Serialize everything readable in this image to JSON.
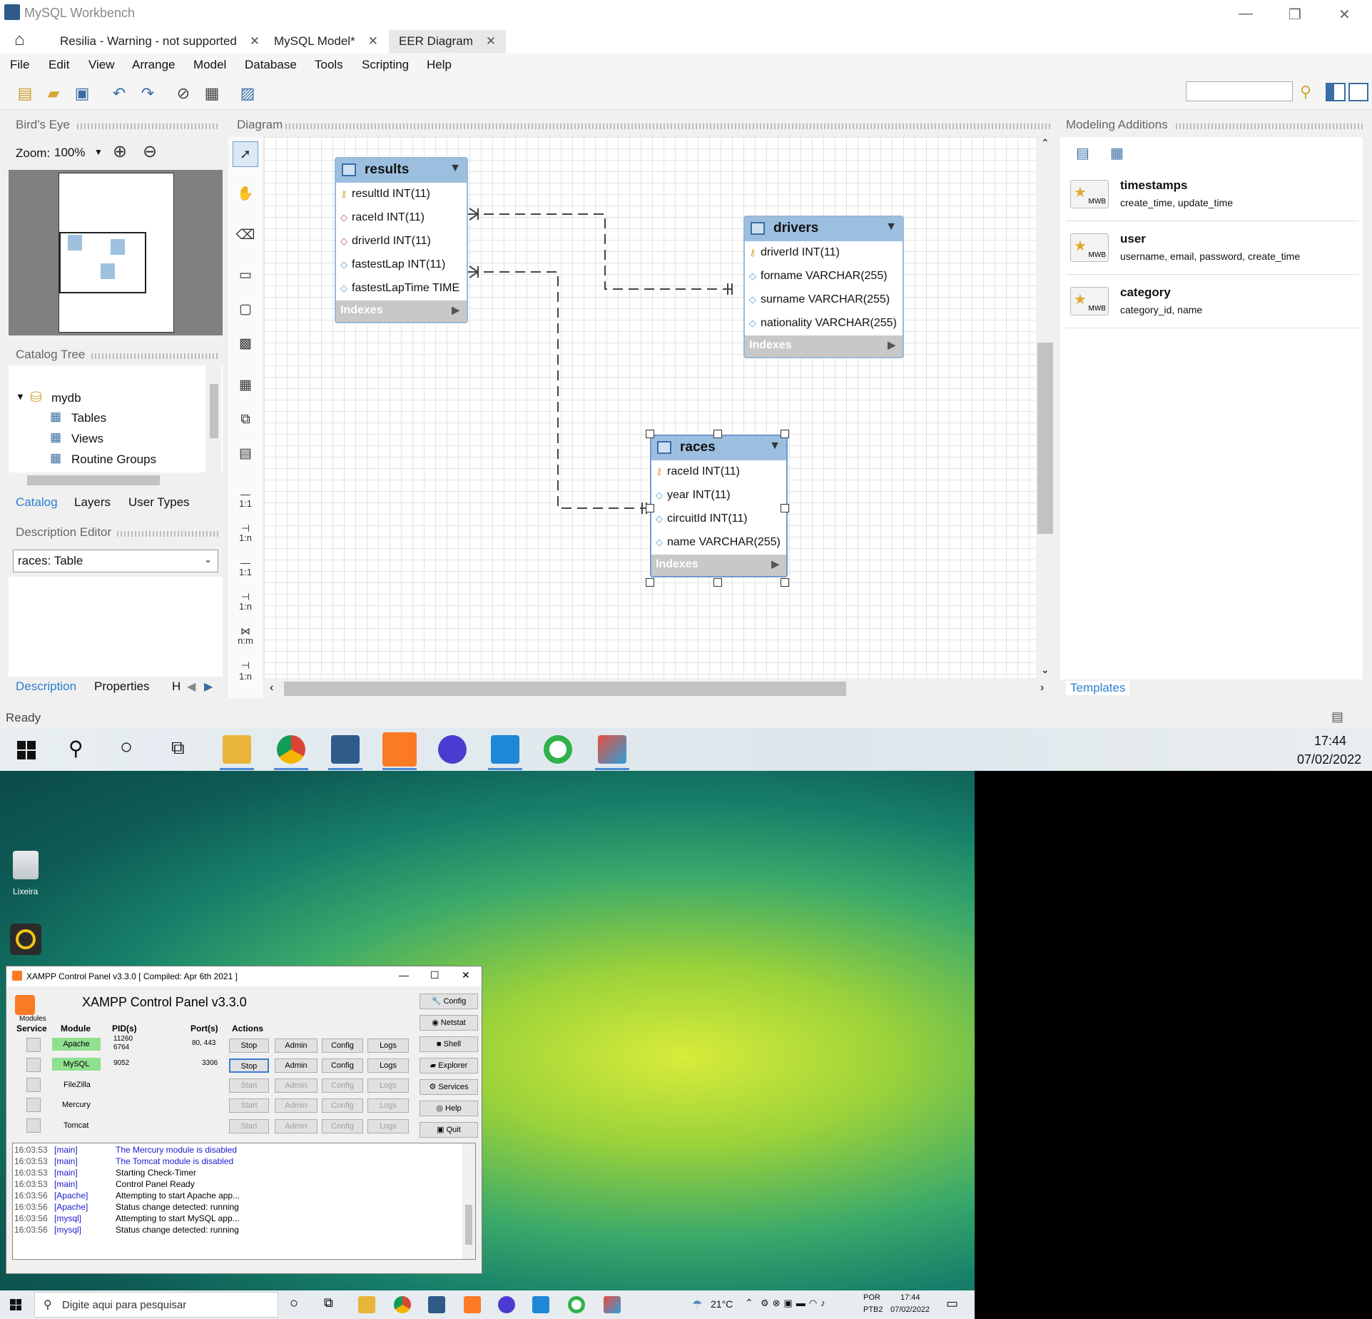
{
  "workbench": {
    "title": "MySQL Workbench",
    "tabs": [
      {
        "label": "Resilia - Warning - not supported"
      },
      {
        "label": "MySQL Model*"
      },
      {
        "label": "EER Diagram"
      }
    ],
    "menu": [
      "File",
      "Edit",
      "View",
      "Arrange",
      "Model",
      "Database",
      "Tools",
      "Scripting",
      "Help"
    ],
    "panels": {
      "birds_eye": "Bird's Eye",
      "zoom_label": "Zoom:",
      "zoom_value": "100%",
      "catalog_tree": "Catalog Tree",
      "diagram": "Diagram",
      "modeling_additions": "Modeling Additions",
      "description_editor": "Description Editor"
    },
    "catalog": {
      "root": "mydb",
      "items": [
        "Tables",
        "Views",
        "Routine Groups"
      ]
    },
    "catalog_tabs": [
      "Catalog",
      "Layers",
      "User Types"
    ],
    "description_combo": "races: Table",
    "lower_tabs": [
      "Description",
      "Properties",
      "H"
    ],
    "palette_labels": [
      "1:1",
      "1:n",
      "1:1",
      "1:n",
      "n:m",
      "1:n"
    ],
    "tables": {
      "results": {
        "name": "results",
        "columns": [
          "resultId INT(11)",
          "raceId INT(11)",
          "driverId INT(11)",
          "fastestLap INT(11)",
          "fastestLapTime TIME"
        ],
        "indexes": "Indexes"
      },
      "drivers": {
        "name": "drivers",
        "columns": [
          "driverId INT(11)",
          "forname VARCHAR(255)",
          "surname VARCHAR(255)",
          "nationality VARCHAR(255)"
        ],
        "indexes": "Indexes"
      },
      "races": {
        "name": "races",
        "columns": [
          "raceId INT(11)",
          "year INT(11)",
          "circuitId INT(11)",
          "name VARCHAR(255)"
        ],
        "indexes": "Indexes"
      }
    },
    "templates": [
      {
        "name": "timestamps",
        "fields": "create_time, update_time"
      },
      {
        "name": "user",
        "fields": "username, email, password, create_time"
      },
      {
        "name": "category",
        "fields": "category_id, name"
      }
    ],
    "templates_tab": "Templates",
    "status": "Ready"
  },
  "taskbar_top": {
    "time": "17:44",
    "date": "07/02/2022"
  },
  "desktop": {
    "icons": [
      {
        "label": "Lixeira"
      }
    ]
  },
  "xampp": {
    "title": "XAMPP Control Panel v3.3.0   [ Compiled: Apr 6th 2021 ]",
    "heading": "XAMPP Control Panel v3.3.0",
    "modules_label": "Modules",
    "headers": {
      "service": "Service",
      "module": "Module",
      "pids": "PID(s)",
      "ports": "Port(s)",
      "actions": "Actions"
    },
    "rows": [
      {
        "module": "Apache",
        "pid1": "11260",
        "pid2": "6764",
        "ports": "80, 443",
        "action": "Stop",
        "running": true
      },
      {
        "module": "MySQL",
        "pid1": "9052",
        "pid2": "",
        "ports": "3306",
        "action": "Stop",
        "running": true
      },
      {
        "module": "FileZilla",
        "pid1": "",
        "pid2": "",
        "ports": "",
        "action": "Start",
        "running": false
      },
      {
        "module": "Mercury",
        "pid1": "",
        "pid2": "",
        "ports": "",
        "action": "Start",
        "running": false
      },
      {
        "module": "Tomcat",
        "pid1": "",
        "pid2": "",
        "ports": "",
        "action": "Start",
        "running": false
      }
    ],
    "row_buttons": [
      "Admin",
      "Config",
      "Logs"
    ],
    "side_buttons": [
      "Config",
      "Netstat",
      "Shell",
      "Explorer",
      "Services",
      "Help",
      "Quit"
    ],
    "log": [
      {
        "time": "16:03:53",
        "module": "[main]",
        "msg": "The Mercury module is disabled",
        "blue": true
      },
      {
        "time": "16:03:53",
        "module": "[main]",
        "msg": "The Tomcat module is disabled",
        "blue": true
      },
      {
        "time": "16:03:53",
        "module": "[main]",
        "msg": "Starting Check-Timer",
        "blue": false
      },
      {
        "time": "16:03:53",
        "module": "[main]",
        "msg": "Control Panel Ready",
        "blue": false
      },
      {
        "time": "16:03:56",
        "module": "[Apache]",
        "msg": "Attempting to start Apache app...",
        "blue": false
      },
      {
        "time": "16:03:56",
        "module": "[Apache]",
        "msg": "Status change detected: running",
        "blue": false
      },
      {
        "time": "16:03:56",
        "module": "[mysql]",
        "msg": "Attempting to start MySQL app...",
        "blue": false
      },
      {
        "time": "16:03:56",
        "module": "[mysql]",
        "msg": "Status change detected: running",
        "blue": false
      }
    ]
  },
  "taskbar_bottom": {
    "search_placeholder": "Digite aqui para pesquisar",
    "weather": "21°C",
    "lang1": "POR",
    "lang2": "PTB2",
    "time": "17:44",
    "date": "07/02/2022"
  }
}
